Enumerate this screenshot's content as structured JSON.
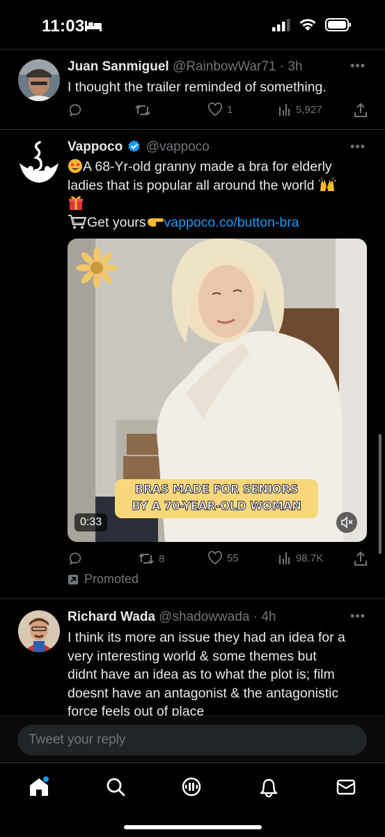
{
  "status_bar": {
    "time": "11:03"
  },
  "tweets": [
    {
      "name": "Juan Sanmiguel",
      "handle": "@RainbowWar71 · 3h",
      "text": "I thought the trailer reminded of something.",
      "likes": "1",
      "views": "5,927"
    },
    {
      "name": "Vappoco",
      "handle": "@vappoco",
      "line1": "A 68-Yr-old granny made a bra for elderly",
      "line2": "ladies that is popular all around the world",
      "cta": "Get yours",
      "link": "vappoco.co/button-bra",
      "video_caption_1": "BRAS MADE FOR SENIORS",
      "video_caption_2": "BY A 70-YEAR-OLD WOMAN",
      "video_time": "0:33",
      "retweets": "8",
      "likes": "55",
      "views": "98.7K",
      "promoted": "Promoted"
    },
    {
      "name": "Richard Wada",
      "handle": "@shadowwada · 4h",
      "lines": [
        "I think its more an issue they had an idea for a",
        "very interesting world & some themes but",
        "didnt have an idea as to what the plot is; film",
        "doesnt have an antagonist & the antagonistic",
        "force feels out of place"
      ]
    }
  ],
  "reply": {
    "placeholder": "Tweet your reply"
  },
  "colors": {
    "accent": "#1d9bf0",
    "muted": "#71767b",
    "background": "#000000"
  },
  "icons": [
    "comment-icon",
    "retweet-icon",
    "heart-icon",
    "views-icon",
    "share-icon",
    "verified-icon",
    "mute-icon",
    "home-icon",
    "search-icon",
    "spaces-icon",
    "notifications-icon",
    "messages-icon"
  ]
}
